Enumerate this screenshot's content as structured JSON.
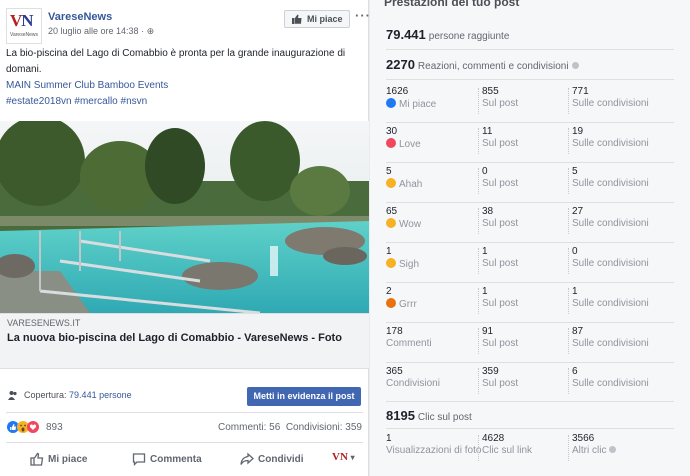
{
  "post": {
    "page_name": "VareseNews",
    "date": "20 luglio alle ore 14:38 ·",
    "like_button": "Mi piace",
    "more": "···",
    "logo_sub": "VareseNews",
    "text": "La bio-piscina del Lago di Comabbio è pronta per la grande inaugurazione di domani.",
    "link1": "MAIN Summer Club Bamboo Events",
    "hashtags": "#estate2018vn #mercallo #nsvn",
    "linkbox": {
      "source": "VARESENEWS.IT",
      "title": "La nuova bio-piscina del Lago di Comabbio - VareseNews - Foto"
    },
    "coverage_label": "Copertura:",
    "coverage_value": "79.441 persone",
    "boost_button": "Metti in evidenza il post",
    "reactions_count": "893",
    "comments": "Commenti: 56",
    "shares": "Condivisioni: 359",
    "actions": {
      "like": "Mi piace",
      "comment": "Commenta",
      "share": "Condividi"
    },
    "brand_short": "VN"
  },
  "stats": {
    "title": "Prestazioni del tuo post",
    "reach_num": "79.441",
    "reach_lbl": "persone raggiunte",
    "engagement_num": "2270",
    "engagement_lbl": "Reazioni, commenti e condivisioni",
    "rows": [
      {
        "n1": "1626",
        "l1": "Mi piace",
        "n2": "855",
        "l2": "Sul post",
        "n3": "771",
        "l3": "Sulle condivisioni"
      },
      {
        "n1": "30",
        "l1": "Love",
        "n2": "11",
        "l2": "Sul post",
        "n3": "19",
        "l3": "Sulle condivisioni"
      },
      {
        "n1": "5",
        "l1": "Ahah",
        "n2": "0",
        "l2": "Sul post",
        "n3": "5",
        "l3": "Sulle condivisioni"
      },
      {
        "n1": "65",
        "l1": "Wow",
        "n2": "38",
        "l2": "Sul post",
        "n3": "27",
        "l3": "Sulle condivisioni"
      },
      {
        "n1": "1",
        "l1": "Sigh",
        "n2": "1",
        "l2": "Sul post",
        "n3": "0",
        "l3": "Sulle condivisioni"
      },
      {
        "n1": "2",
        "l1": "Grrr",
        "n2": "1",
        "l2": "Sul post",
        "n3": "1",
        "l3": "Sulle condivisioni"
      },
      {
        "n1": "178",
        "l1": "Commenti",
        "n2": "91",
        "l2": "Sul post",
        "n3": "87",
        "l3": "Sulle condivisioni"
      },
      {
        "n1": "365",
        "l1": "Condivisioni",
        "n2": "359",
        "l2": "Sul post",
        "n3": "6",
        "l3": "Sulle condivisioni"
      }
    ],
    "clicks_num": "8195",
    "clicks_lbl": "Clic sul post",
    "clicks": [
      {
        "n": "1",
        "l": "Visualizzazioni di foto"
      },
      {
        "n": "4628",
        "l": "Clic sul link"
      },
      {
        "n": "3566",
        "l": "Altri clic"
      }
    ]
  },
  "colors": {
    "fb_blue": "#4267b2",
    "link": "#365899",
    "like": "#2078f4",
    "love": "#f0475d",
    "haha": "#f7b125",
    "angry": "#e9710f"
  }
}
